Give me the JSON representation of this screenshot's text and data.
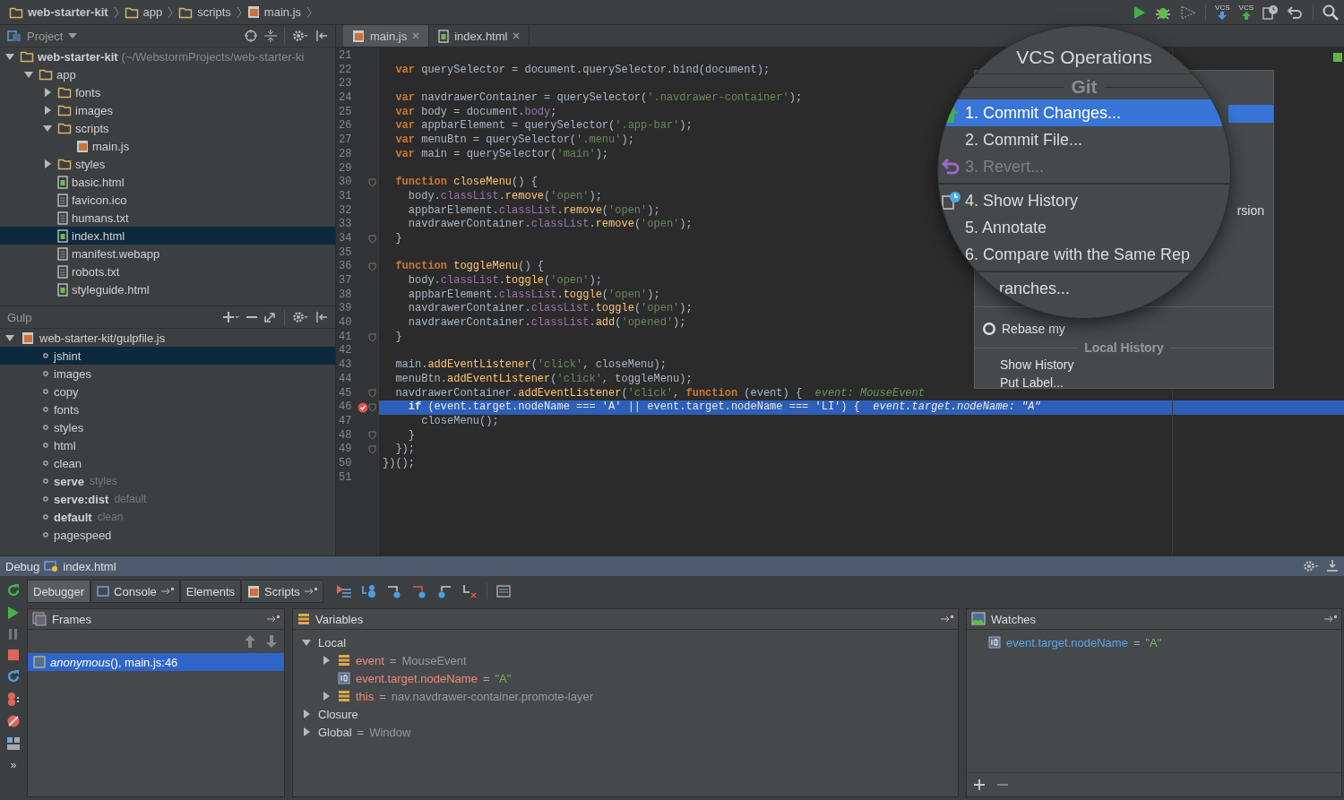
{
  "breadcrumbs": [
    {
      "label": "web-starter-kit",
      "kind": "project"
    },
    {
      "label": "app",
      "kind": "folder"
    },
    {
      "label": "scripts",
      "kind": "folder"
    },
    {
      "label": "main.js",
      "kind": "js"
    }
  ],
  "toolbar": {
    "vcs_labels": [
      "VCS",
      "VCS"
    ]
  },
  "project_panel": {
    "title": "Project",
    "tree": [
      {
        "label": "web-starter-kit",
        "note": "(~/WebstormProjects/web-starter-ki",
        "kind": "folder",
        "expanded": true,
        "selected": false,
        "children": [
          {
            "label": "app",
            "kind": "folder",
            "expanded": true,
            "selected": false,
            "children": [
              {
                "label": "fonts",
                "kind": "folder",
                "expanded": false,
                "selected": false
              },
              {
                "label": "images",
                "kind": "folder",
                "expanded": false,
                "selected": false
              },
              {
                "label": "scripts",
                "kind": "folder",
                "expanded": true,
                "selected": false,
                "children": [
                  {
                    "label": "main.js",
                    "kind": "js",
                    "selected": false
                  }
                ]
              },
              {
                "label": "styles",
                "kind": "folder",
                "expanded": false,
                "selected": false
              },
              {
                "label": "basic.html",
                "kind": "html",
                "selected": false
              },
              {
                "label": "favicon.ico",
                "kind": "file",
                "selected": false
              },
              {
                "label": "humans.txt",
                "kind": "file",
                "selected": false
              },
              {
                "label": "index.html",
                "kind": "html",
                "selected": true
              },
              {
                "label": "manifest.webapp",
                "kind": "file",
                "selected": false
              },
              {
                "label": "robots.txt",
                "kind": "file",
                "selected": false
              },
              {
                "label": "styleguide.html",
                "kind": "html",
                "selected": false
              }
            ]
          }
        ]
      }
    ]
  },
  "gulp_panel": {
    "title": "Gulp",
    "file": "web-starter-kit/gulpfile.js",
    "expanded": true,
    "tasks": [
      {
        "name": "jshint",
        "selected": true
      },
      {
        "name": "images",
        "selected": false
      },
      {
        "name": "copy",
        "selected": false
      },
      {
        "name": "fonts",
        "selected": false
      },
      {
        "name": "styles",
        "selected": false
      },
      {
        "name": "html",
        "selected": false
      },
      {
        "name": "clean",
        "selected": false
      },
      {
        "name": "serve",
        "deps": "styles",
        "selected": false
      },
      {
        "name": "serve:dist",
        "deps": "default",
        "selected": false
      },
      {
        "name": "default",
        "deps": "clean",
        "selected": false
      },
      {
        "name": "pagespeed",
        "selected": false
      }
    ]
  },
  "editor_tabs": [
    {
      "label": "main.js",
      "kind": "js",
      "selected": true
    },
    {
      "label": "index.html",
      "kind": "html",
      "selected": false
    }
  ],
  "code": {
    "lines": [
      {
        "number": "21",
        "fold": false,
        "breakpoint": false
      },
      {
        "number": "22",
        "tokens": [
          {
            "kind": "kw",
            "text": "  var"
          },
          {
            "kind": "tx",
            "text": " querySelector = document.querySelector.bind(document);"
          }
        ],
        "fold": false,
        "breakpoint": false,
        "current": false
      },
      {
        "number": "23",
        "fold": false,
        "breakpoint": false
      },
      {
        "number": "24",
        "tokens": [
          {
            "kind": "kw",
            "text": "  var"
          },
          {
            "kind": "tx",
            "text": " navdrawerContainer = querySelector("
          },
          {
            "kind": "str",
            "text": "'.navdrawer-container'"
          },
          {
            "kind": "tx",
            "text": ");"
          }
        ],
        "fold": false,
        "breakpoint": false,
        "current": false
      },
      {
        "number": "25",
        "tokens": [
          {
            "kind": "kw",
            "text": "  var"
          },
          {
            "kind": "tx",
            "text": " body = document."
          },
          {
            "kind": "prop",
            "text": "body"
          },
          {
            "kind": "tx",
            "text": ";"
          }
        ],
        "fold": false,
        "breakpoint": false,
        "current": false
      },
      {
        "number": "26",
        "tokens": [
          {
            "kind": "kw",
            "text": "  var"
          },
          {
            "kind": "tx",
            "text": " appbarElement = querySelector("
          },
          {
            "kind": "str",
            "text": "'.app-bar'"
          },
          {
            "kind": "tx",
            "text": ");"
          }
        ],
        "fold": false,
        "breakpoint": false,
        "current": false
      },
      {
        "number": "27",
        "tokens": [
          {
            "kind": "kw",
            "text": "  var"
          },
          {
            "kind": "tx",
            "text": " menuBtn = querySelector("
          },
          {
            "kind": "str",
            "text": "'.menu'"
          },
          {
            "kind": "tx",
            "text": ");"
          }
        ],
        "fold": false,
        "breakpoint": false,
        "current": false
      },
      {
        "number": "28",
        "tokens": [
          {
            "kind": "kw",
            "text": "  var"
          },
          {
            "kind": "tx",
            "text": " main = querySelector("
          },
          {
            "kind": "str",
            "text": "'main'"
          },
          {
            "kind": "tx",
            "text": ");"
          }
        ],
        "fold": false,
        "breakpoint": false,
        "current": false
      },
      {
        "number": "29",
        "fold": false,
        "breakpoint": false
      },
      {
        "number": "30",
        "tokens": [
          {
            "kind": "kw",
            "text": "  function"
          },
          {
            "kind": "fn",
            "text": " closeMenu"
          },
          {
            "kind": "tx",
            "text": "() {"
          }
        ],
        "fold": true,
        "breakpoint": false,
        "current": false
      },
      {
        "number": "31",
        "tokens": [
          {
            "kind": "tx",
            "text": "    body."
          },
          {
            "kind": "prop",
            "text": "classList"
          },
          {
            "kind": "tx",
            "text": "."
          },
          {
            "kind": "fn",
            "text": "remove"
          },
          {
            "kind": "tx",
            "text": "("
          },
          {
            "kind": "str",
            "text": "'open'"
          },
          {
            "kind": "tx",
            "text": ");"
          }
        ],
        "fold": false,
        "breakpoint": false,
        "current": false
      },
      {
        "number": "32",
        "tokens": [
          {
            "kind": "tx",
            "text": "    appbarElement."
          },
          {
            "kind": "prop",
            "text": "classList"
          },
          {
            "kind": "tx",
            "text": "."
          },
          {
            "kind": "fn",
            "text": "remove"
          },
          {
            "kind": "tx",
            "text": "("
          },
          {
            "kind": "str",
            "text": "'open'"
          },
          {
            "kind": "tx",
            "text": ");"
          }
        ],
        "fold": false,
        "breakpoint": false,
        "current": false
      },
      {
        "number": "33",
        "tokens": [
          {
            "kind": "tx",
            "text": "    navdrawerContainer."
          },
          {
            "kind": "prop",
            "text": "classList"
          },
          {
            "kind": "tx",
            "text": "."
          },
          {
            "kind": "fn",
            "text": "remove"
          },
          {
            "kind": "tx",
            "text": "("
          },
          {
            "kind": "str",
            "text": "'open'"
          },
          {
            "kind": "tx",
            "text": ");"
          }
        ],
        "fold": false,
        "breakpoint": false,
        "current": false
      },
      {
        "number": "34",
        "tokens": [
          {
            "kind": "tx",
            "text": "  }"
          }
        ],
        "fold": true,
        "breakpoint": false,
        "current": false
      },
      {
        "number": "35",
        "fold": false,
        "breakpoint": false
      },
      {
        "number": "36",
        "tokens": [
          {
            "kind": "kw",
            "text": "  function"
          },
          {
            "kind": "fn",
            "text": " toggleMenu"
          },
          {
            "kind": "tx",
            "text": "() {"
          }
        ],
        "fold": true,
        "breakpoint": false,
        "current": false
      },
      {
        "number": "37",
        "tokens": [
          {
            "kind": "tx",
            "text": "    body."
          },
          {
            "kind": "prop",
            "text": "classList"
          },
          {
            "kind": "tx",
            "text": "."
          },
          {
            "kind": "fn",
            "text": "toggle"
          },
          {
            "kind": "tx",
            "text": "("
          },
          {
            "kind": "str",
            "text": "'open'"
          },
          {
            "kind": "tx",
            "text": ");"
          }
        ],
        "fold": false,
        "breakpoint": false,
        "current": false
      },
      {
        "number": "38",
        "tokens": [
          {
            "kind": "tx",
            "text": "    appbarElement."
          },
          {
            "kind": "prop",
            "text": "classList"
          },
          {
            "kind": "tx",
            "text": "."
          },
          {
            "kind": "fn",
            "text": "toggle"
          },
          {
            "kind": "tx",
            "text": "("
          },
          {
            "kind": "str",
            "text": "'open'"
          },
          {
            "kind": "tx",
            "text": ");"
          }
        ],
        "fold": false,
        "breakpoint": false,
        "current": false
      },
      {
        "number": "39",
        "tokens": [
          {
            "kind": "tx",
            "text": "    navdrawerContainer."
          },
          {
            "kind": "prop",
            "text": "classList"
          },
          {
            "kind": "tx",
            "text": "."
          },
          {
            "kind": "fn",
            "text": "toggle"
          },
          {
            "kind": "tx",
            "text": "("
          },
          {
            "kind": "str",
            "text": "'open'"
          },
          {
            "kind": "tx",
            "text": ");"
          }
        ],
        "fold": false,
        "breakpoint": false,
        "current": false
      },
      {
        "number": "40",
        "tokens": [
          {
            "kind": "tx",
            "text": "    navdrawerContainer."
          },
          {
            "kind": "prop",
            "text": "classList"
          },
          {
            "kind": "tx",
            "text": "."
          },
          {
            "kind": "fn",
            "text": "add"
          },
          {
            "kind": "tx",
            "text": "("
          },
          {
            "kind": "str",
            "text": "'opened'"
          },
          {
            "kind": "tx",
            "text": ");"
          }
        ],
        "fold": false,
        "breakpoint": false,
        "current": false
      },
      {
        "number": "41",
        "tokens": [
          {
            "kind": "tx",
            "text": "  }"
          }
        ],
        "fold": true,
        "breakpoint": false,
        "current": false
      },
      {
        "number": "42",
        "fold": false,
        "breakpoint": false
      },
      {
        "number": "43",
        "tokens": [
          {
            "kind": "tx",
            "text": "  main."
          },
          {
            "kind": "fn",
            "text": "addEventListener"
          },
          {
            "kind": "tx",
            "text": "("
          },
          {
            "kind": "str",
            "text": "'click'"
          },
          {
            "kind": "tx",
            "text": ", closeMenu);"
          }
        ],
        "fold": false,
        "breakpoint": false,
        "current": false
      },
      {
        "number": "44",
        "tokens": [
          {
            "kind": "tx",
            "text": "  menuBtn."
          },
          {
            "kind": "fn",
            "text": "addEventListener"
          },
          {
            "kind": "tx",
            "text": "("
          },
          {
            "kind": "str",
            "text": "'click'"
          },
          {
            "kind": "tx",
            "text": ", toggleMenu);"
          }
        ],
        "fold": false,
        "breakpoint": false,
        "current": false
      },
      {
        "number": "45",
        "tokens": [
          {
            "kind": "tx",
            "text": "  navdrawerContainer."
          },
          {
            "kind": "fn",
            "text": "addEventListener"
          },
          {
            "kind": "tx",
            "text": "("
          },
          {
            "kind": "str",
            "text": "'click'"
          },
          {
            "kind": "tx",
            "text": ", "
          },
          {
            "kind": "kw",
            "text": "function"
          },
          {
            "kind": "tx",
            "text": " (event) {  "
          },
          {
            "kind": "hint",
            "text": "event: MouseEvent"
          }
        ],
        "fold": true,
        "breakpoint": false,
        "current": false
      },
      {
        "number": "46",
        "tokens": [
          {
            "kind": "kw",
            "text": "    if"
          },
          {
            "kind": "tx",
            "text": " (event.target.nodeName === "
          },
          {
            "kind": "str",
            "text": "'A'"
          },
          {
            "kind": "tx",
            "text": " || event.target.nodeName === "
          },
          {
            "kind": "str",
            "text": "'LI'"
          },
          {
            "kind": "tx",
            "text": ") {  "
          },
          {
            "kind": "hint",
            "text": "event.target.nodeName: \"A\""
          }
        ],
        "fold": true,
        "breakpoint": true,
        "current": true
      },
      {
        "number": "47",
        "tokens": [
          {
            "kind": "tx",
            "text": "      closeMenu();"
          }
        ],
        "fold": false,
        "breakpoint": false,
        "current": false
      },
      {
        "number": "48",
        "tokens": [
          {
            "kind": "tx",
            "text": "    }"
          }
        ],
        "fold": true,
        "breakpoint": false,
        "current": false
      },
      {
        "number": "49",
        "tokens": [
          {
            "kind": "tx",
            "text": "  });"
          }
        ],
        "fold": true,
        "breakpoint": false,
        "current": false
      },
      {
        "number": "50",
        "tokens": [
          {
            "kind": "tx",
            "text": "})();"
          }
        ],
        "fold": false,
        "breakpoint": false,
        "current": false
      },
      {
        "number": "51",
        "fold": false,
        "breakpoint": false
      }
    ]
  },
  "vcs_popup": {
    "rows": [
      {
        "kind": "item",
        "selected": true
      },
      {
        "kind": "item",
        "label": "rsion",
        "selected": false
      },
      {
        "kind": "divider"
      },
      {
        "kind": "github",
        "label": "Rebase my",
        "selected": false
      },
      {
        "kind": "separator",
        "label": "Local History"
      },
      {
        "kind": "item",
        "label": "Show History",
        "selected": false
      },
      {
        "kind": "item",
        "label": "Put Label...",
        "selected": false
      }
    ]
  },
  "magnifier": {
    "title": "VCS Operations",
    "rows": [
      {
        "kind": "separator",
        "label": "Git"
      },
      {
        "kind": "commit",
        "label": "1. Commit Changes...",
        "selected": true,
        "disabled": false
      },
      {
        "kind": "item",
        "label": "2. Commit File...",
        "selected": false,
        "disabled": false
      },
      {
        "kind": "revert",
        "label": "3. Revert...",
        "selected": false,
        "disabled": true
      },
      {
        "kind": "divider"
      },
      {
        "kind": "history",
        "label": "4. Show History",
        "selected": false,
        "disabled": false
      },
      {
        "kind": "item",
        "label": "5. Annotate",
        "selected": false,
        "disabled": false
      },
      {
        "kind": "item",
        "label": "6. Compare with the Same Rep",
        "selected": false,
        "disabled": false
      },
      {
        "kind": "divider"
      },
      {
        "kind": "item",
        "label": "ranches...",
        "selected": false,
        "disabled": false
      }
    ]
  },
  "debug": {
    "title": "Debug",
    "config": "index.html",
    "more": "»",
    "tabs": [
      {
        "label": "Debugger",
        "kind": "plain",
        "selected": true
      },
      {
        "label": "Console",
        "kind": "console",
        "selected": false
      },
      {
        "label": "Elements",
        "kind": "plain",
        "selected": false
      },
      {
        "label": "Scripts",
        "kind": "scripts",
        "selected": false
      }
    ],
    "frames": {
      "title": "Frames",
      "items": [
        {
          "label": "*anonymous*(), main.js:46",
          "selected": true
        }
      ]
    },
    "variables": {
      "title": "Variables",
      "tree": [
        {
          "name": "Local",
          "kind": "scope",
          "expanded": true,
          "children": [
            {
              "name": "event",
              "operator": "=",
              "value": "MouseEvent",
              "kind": "object",
              "expanded": false
            },
            {
              "name": "event.target.nodeName",
              "operator": "=",
              "value": "\"A\"",
              "kind": "primitive"
            },
            {
              "name": "this",
              "operator": "=",
              "value": "nav.navdrawer-container.promote-layer",
              "kind": "object",
              "expanded": false
            }
          ]
        },
        {
          "name": "Closure",
          "kind": "scope",
          "expanded": false
        },
        {
          "name": "Global",
          "operator": "=",
          "value": "Window",
          "kind": "scope",
          "expanded": false
        }
      ]
    },
    "watches": {
      "title": "Watches",
      "items": [
        {
          "name": "event.target.nodeName",
          "operator": "=",
          "value": "\"A\""
        }
      ]
    }
  }
}
